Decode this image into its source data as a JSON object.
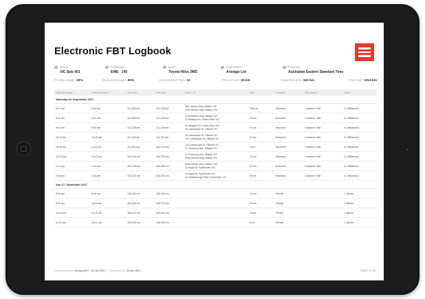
{
  "title": "Electronic FBT Logbook",
  "info": [
    {
      "label": "Vehicle",
      "value": "VIC Sale 001",
      "icon": "car-icon"
    },
    {
      "label": "Registration",
      "value": "EWE - 245",
      "icon": "tag-icon"
    },
    {
      "label": "Model",
      "value": "Toyota Hilux 2WD",
      "icon": "gear-icon"
    },
    {
      "label": "Organisation",
      "value": "Anstage Ltd",
      "icon": "building-icon"
    },
    {
      "label": "Timezone",
      "value": "Australian Eastern Standard Time",
      "icon": "clock-icon"
    }
  ],
  "stats": [
    {
      "label": "Private usage:",
      "value": "20%"
    },
    {
      "label": "Business usage:",
      "value": "80%"
    },
    {
      "label": "Unclassified Trips:",
      "value": "12"
    },
    {
      "label": "Private Dist:",
      "value": "25 km"
    },
    {
      "label": "Business Dist:",
      "value": "102 km"
    },
    {
      "label": "Total Dist:",
      "value": "1314 km"
    }
  ],
  "columns": [
    "Date trip began",
    "Date trip ended",
    "Odo start",
    "Odo end",
    "From / To",
    "Dist.",
    "Purpose",
    "Trip reason",
    "Driver"
  ],
  "sections": [
    {
      "date": "Saturday 16, September 2017",
      "rows": [
        {
          "start": "8:21 am",
          "end": "8:41 am",
          "odo_start": "112,009 km",
          "odo_end": "112,108 km",
          "from": "183, Melton Hwy, Melton VIC",
          "to": "2345 Melton Hwy, Melton VIC",
          "dist": "108 km",
          "purpose": "Business",
          "reason": "Customer Visit",
          "driver": "A. Williamson"
        },
        {
          "start": "9:11 am",
          "end": "9:51 am",
          "odo_start": "112,069 km",
          "odo_end": "112,108 km",
          "from": "2345 Melton Hwy, Melton VIC",
          "to": "31 Boadys Rd, Fraser Rise VIC",
          "dist": "30 km",
          "purpose": "Business",
          "reason": "Customer Visit",
          "driver": "A. Williamson"
        },
        {
          "start": "9:42 am",
          "end": "9:52 am",
          "odo_start": "112,108 km",
          "odo_end": "112,158 km",
          "from": "31 Boadys Rd, Fraser Rise VIC",
          "to": "23 Landscape Dr, Hillside VIC",
          "dist": "41 km",
          "purpose": "Business",
          "reason": "Customer Visit",
          "driver": "A. Williamson"
        },
        {
          "start": "10:12 am",
          "end": "10:15 am",
          "odo_start": "112,200 km",
          "odo_end": "112,211 km",
          "from": "23 Landscape Dr, Hillside VIC",
          "to": "141 Landscape Dr, Hillside VIC",
          "dist": "11 km",
          "purpose": "Business",
          "reason": "Customer Visit",
          "driver": "A. Williamson"
        },
        {
          "start": "10:48 am",
          "end": "11:02 am",
          "odo_start": "112,211 km",
          "odo_end": "182,215 km",
          "from": "141 Landscape Dr, Hillside VIC",
          "to": "11 Tomorrey Ave, Hillside VIC",
          "dist": "4 km",
          "purpose": "Business",
          "reason": "Customer Visit",
          "driver": "A. Williamson"
        },
        {
          "start": "12:21 pm",
          "end": "12:41 pm",
          "odo_start": "182,215 km",
          "odo_end": "182,235 km",
          "from": "11 Tomorrey Ave, Hillside VIC",
          "to": "2290 Melton Hwy, Melton VIC",
          "dist": "20 km",
          "purpose": "Business",
          "reason": "Customer Visit",
          "driver": "A. Williamson"
        },
        {
          "start": "1:21 pm",
          "end": "1:41 pm",
          "odo_start": "182,235 km",
          "odo_end": "182,298 km",
          "from": "2290 Melton Hwy, Melton VIC",
          "to": "12 Argyll St, Sydenham VIC",
          "dist": "63 km",
          "purpose": "Business",
          "reason": "Customer Visit",
          "driver": "A. Williamson"
        },
        {
          "start": "2:28 pm",
          "end": "3:24 pm",
          "odo_start": "182,203 km",
          "odo_end": "182,233 km",
          "from": "12 Argyll St, Sydenham VIC",
          "to": "4-2 Marlborough Way, Sydenham VIC",
          "dist": "30 km",
          "purpose": "Business",
          "reason": "Customer Visit",
          "driver": "A. Williamson"
        }
      ]
    },
    {
      "date": "Sun 17, September 2017",
      "rows": [
        {
          "start": "8:30 am",
          "end": "8:50 am",
          "odo_start": "182,333 km",
          "odo_end": "182,343 km",
          "from": "",
          "to": "",
          "dist": "10 km",
          "purpose": "Private",
          "reason": "",
          "driver": "J. Barton"
        },
        {
          "start": "8:30 pm",
          "end": "10:24 am",
          "odo_start": "182,363 km",
          "odo_end": "182,373 km",
          "from": "",
          "to": "",
          "dist": "10 km",
          "purpose": "Private",
          "reason": "",
          "driver": "J. Barton"
        },
        {
          "start": "10:24 am",
          "end": "11:21 am",
          "odo_start": "182,371 km",
          "odo_end": "182,391 km",
          "from": "",
          "to": "",
          "dist": "11 km",
          "purpose": "Private",
          "reason": "",
          "driver": "J. Barton"
        },
        {
          "start": "11:21 am",
          "end": "12:01 am",
          "odo_start": "182,032 km",
          "odo_end": "182,035 km",
          "from": "",
          "to": "",
          "dist": "3 km",
          "purpose": "Private",
          "reason": "",
          "driver": "J. Barton"
        }
      ]
    }
  ],
  "footer": {
    "period_label": "Period Selected:",
    "period_value": "14 Aug 2017 - 22 Jun 2017",
    "generated_label": "Generated on:",
    "generated_value": "20 Jun 2017",
    "page": "PAGE 1 / 20"
  },
  "colors": {
    "brand": "#e63a2e"
  }
}
